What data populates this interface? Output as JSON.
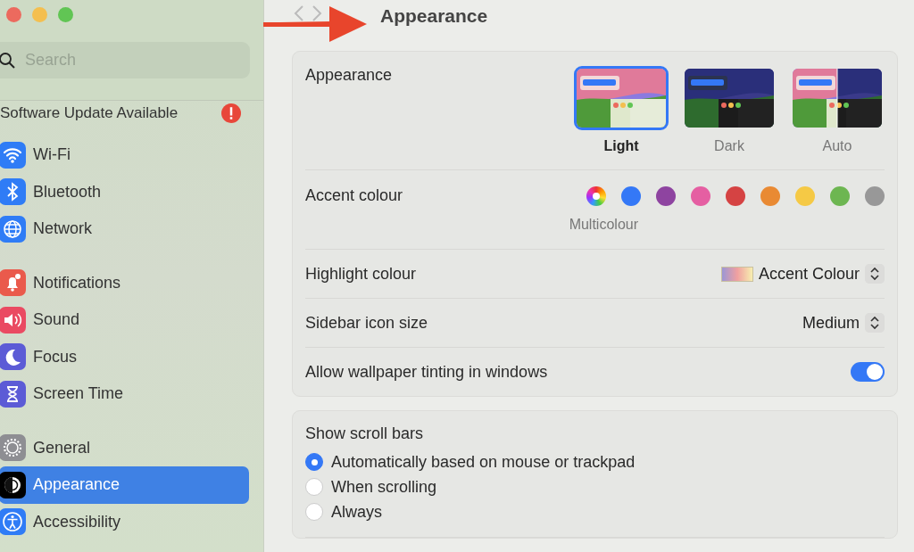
{
  "sidebar": {
    "search": {
      "placeholder": "Search"
    },
    "update_notice": {
      "label": "Software Update Available"
    },
    "groups": [
      [
        {
          "label": "Wi-Fi",
          "selected": false
        },
        {
          "label": "Bluetooth",
          "selected": false
        },
        {
          "label": "Network",
          "selected": false
        }
      ],
      [
        {
          "label": "Notifications",
          "selected": false
        },
        {
          "label": "Sound",
          "selected": false
        },
        {
          "label": "Focus",
          "selected": false
        },
        {
          "label": "Screen Time",
          "selected": false
        }
      ],
      [
        {
          "label": "General",
          "selected": false
        },
        {
          "label": "Appearance",
          "selected": true
        },
        {
          "label": "Accessibility",
          "selected": false
        }
      ]
    ]
  },
  "toolbar": {
    "title": "Appearance"
  },
  "appearance_card": {
    "rows": [
      {
        "kind": "appearance",
        "label": "Appearance",
        "options": [
          {
            "label": "Light",
            "selected": true
          },
          {
            "label": "Dark",
            "selected": false
          },
          {
            "label": "Auto",
            "selected": false
          }
        ]
      },
      {
        "kind": "accent",
        "label": "Accent colour",
        "caption": "Multicolour",
        "swatches": [
          {
            "kind": "multicolour",
            "selected": true
          },
          {
            "kind": "plain",
            "color": "#3478f6",
            "selected": false
          },
          {
            "kind": "plain",
            "color": "#8e44a0",
            "selected": false
          },
          {
            "kind": "plain",
            "color": "#e55fa2",
            "selected": false
          },
          {
            "kind": "plain",
            "color": "#d54343",
            "selected": false
          },
          {
            "kind": "plain",
            "color": "#e98a33",
            "selected": false
          },
          {
            "kind": "plain",
            "color": "#f5c945",
            "selected": false
          },
          {
            "kind": "plain",
            "color": "#6db651",
            "selected": false
          },
          {
            "kind": "plain",
            "color": "#989898",
            "selected": false
          }
        ]
      },
      {
        "kind": "popup",
        "label": "Highlight colour",
        "value": "Accent Colour",
        "swatch": true
      },
      {
        "kind": "popup",
        "label": "Sidebar icon size",
        "value": "Medium",
        "swatch": false
      },
      {
        "kind": "toggle",
        "label": "Allow wallpaper tinting in windows",
        "on": true
      }
    ]
  },
  "scroll_card": {
    "label": "Show scroll bars",
    "options": [
      {
        "label": "Automatically based on mouse or trackpad",
        "selected": true
      },
      {
        "label": "When scrolling",
        "selected": false
      },
      {
        "label": "Always",
        "selected": false
      }
    ]
  }
}
